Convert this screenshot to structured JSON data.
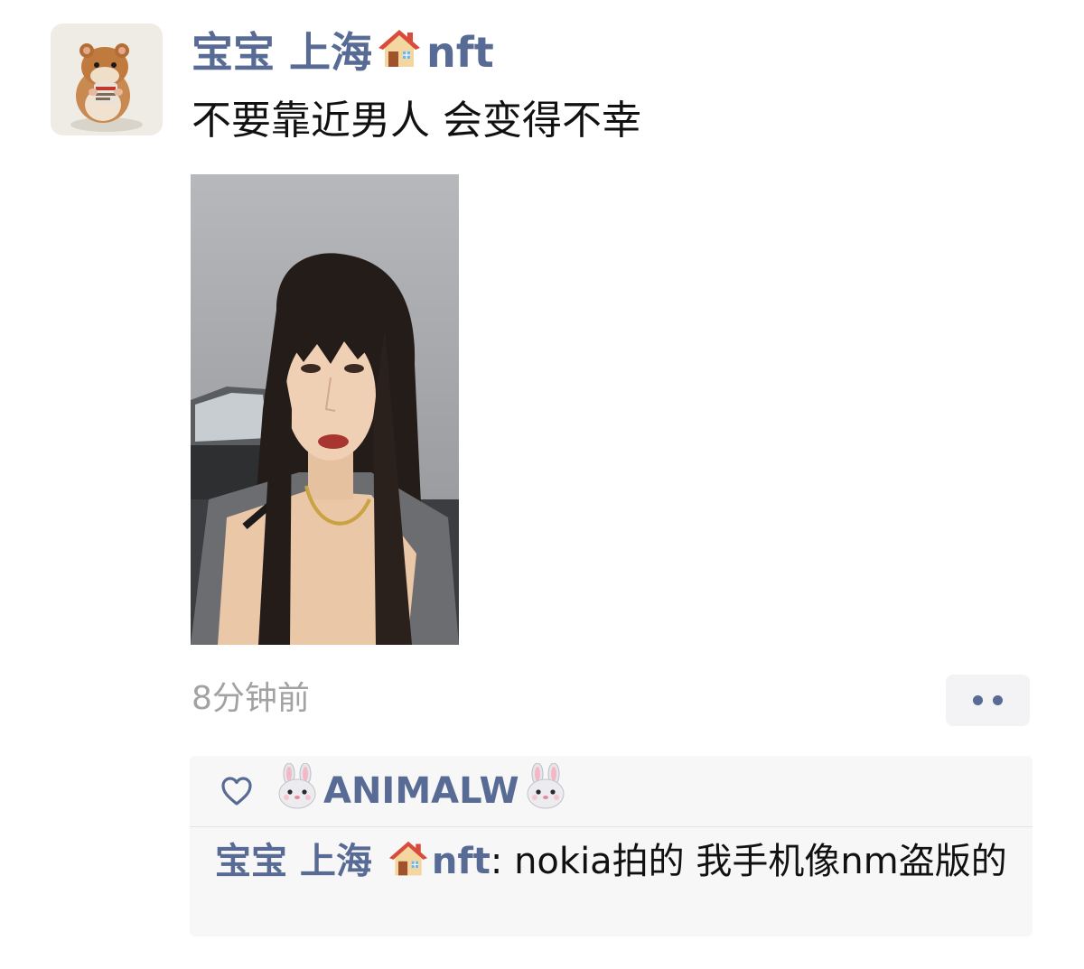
{
  "post": {
    "author": {
      "name": "宝宝 上海",
      "name_suffix": "nft",
      "emoji_icon": "house-emoji"
    },
    "text": "不要靠近男人 会变得不幸",
    "timestamp": "8分钟前",
    "more_icon": "more-dots-icon"
  },
  "interactions": {
    "like_icon": "heart-outline-icon",
    "likers": [
      {
        "name": "ANIMALW",
        "emoji_icon": "rabbit-emoji"
      }
    ],
    "comments": [
      {
        "author": "宝宝 上海",
        "author_suffix": "nft",
        "author_emoji": "house-emoji",
        "separator": ":",
        "text": " nokia拍的 我手机像nm盗版的"
      }
    ]
  },
  "colors": {
    "link": "#576b95",
    "text": "#111111",
    "timestamp": "#a2a2a2",
    "box_background": "#f7f7f7"
  }
}
